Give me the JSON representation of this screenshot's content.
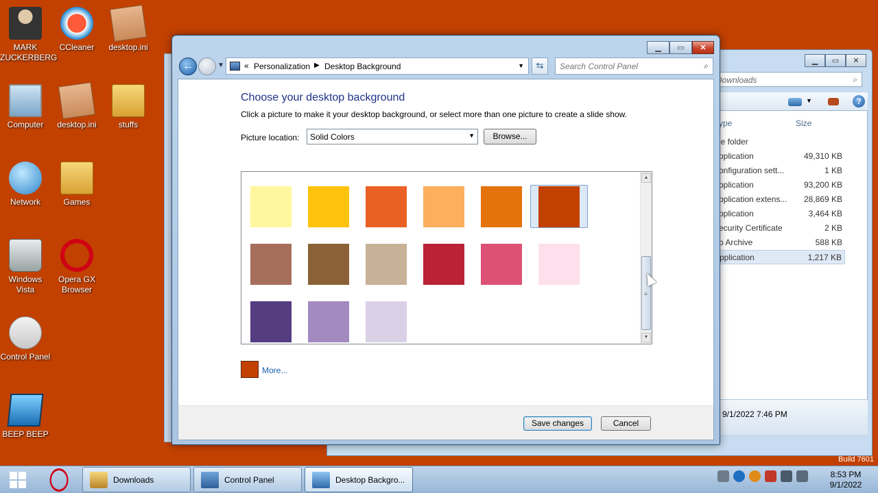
{
  "desktop": {
    "icons": [
      {
        "label": "MARK ZUCKERBERG"
      },
      {
        "label": "CCleaner"
      },
      {
        "label": "desktop.ini"
      },
      {
        "label": "Computer"
      },
      {
        "label": "desktop.ini"
      },
      {
        "label": "stuffs"
      },
      {
        "label": "Network"
      },
      {
        "label": "Games"
      },
      {
        "label": "Windows Vista"
      },
      {
        "label": "Opera GX Browser"
      },
      {
        "label": "Control Panel"
      },
      {
        "label": "BEEP BEEP"
      }
    ],
    "background_color": "#c24100",
    "build_text": "Build 7601"
  },
  "explorer": {
    "search_placeholder": "rch Downloads",
    "columns": {
      "type": "ype",
      "size": "Size"
    },
    "rows": [
      {
        "type": "le folder",
        "size": ""
      },
      {
        "type": "pplication",
        "size": "49,310 KB"
      },
      {
        "type": "onfiguration sett...",
        "size": "1 KB"
      },
      {
        "type": "pplication",
        "size": "93,200 KB"
      },
      {
        "type": "pplication extens...",
        "size": "28,869 KB"
      },
      {
        "type": "pplication",
        "size": "3,464 KB"
      },
      {
        "type": "ecurity Certificate",
        "size": "2 KB"
      },
      {
        "type": "p Archive",
        "size": "588 KB"
      },
      {
        "type": "pplication",
        "size": "1,217 KB"
      }
    ],
    "details_date": "9/1/2022 7:46 PM"
  },
  "window": {
    "breadcrumb": {
      "root_glyph": "«",
      "item1": "Personalization",
      "item2": "Desktop Background"
    },
    "search_placeholder": "Search Control Panel",
    "heading": "Choose your desktop background",
    "subtext": "Click a picture to make it your desktop background, or select more than one picture to create a slide show.",
    "picture_location_label": "Picture location:",
    "picture_location_value": "Solid Colors",
    "browse_label": "Browse...",
    "swatches": [
      {
        "color": "#fff79e"
      },
      {
        "color": "#ffc20e"
      },
      {
        "color": "#ea6125"
      },
      {
        "color": "#fcaf5d"
      },
      {
        "color": "#e3730a"
      },
      {
        "color": "#c24100",
        "selected": true
      },
      {
        "color": "#a86e5c"
      },
      {
        "color": "#8b6237"
      },
      {
        "color": "#c7b197"
      },
      {
        "color": "#bb2235"
      },
      {
        "color": "#dc5174"
      },
      {
        "color": "#fde0ec"
      },
      {
        "color": "#543d81"
      },
      {
        "color": "#a38ac0"
      },
      {
        "color": "#dbd1e6"
      }
    ],
    "more_label": "More...",
    "save_label": "Save changes",
    "cancel_label": "Cancel"
  },
  "taskbar": {
    "buttons": [
      {
        "label": "Downloads"
      },
      {
        "label": "Control Panel"
      },
      {
        "label": "Desktop Backgro..."
      }
    ],
    "time": "8:53 PM",
    "date": "9/1/2022"
  }
}
